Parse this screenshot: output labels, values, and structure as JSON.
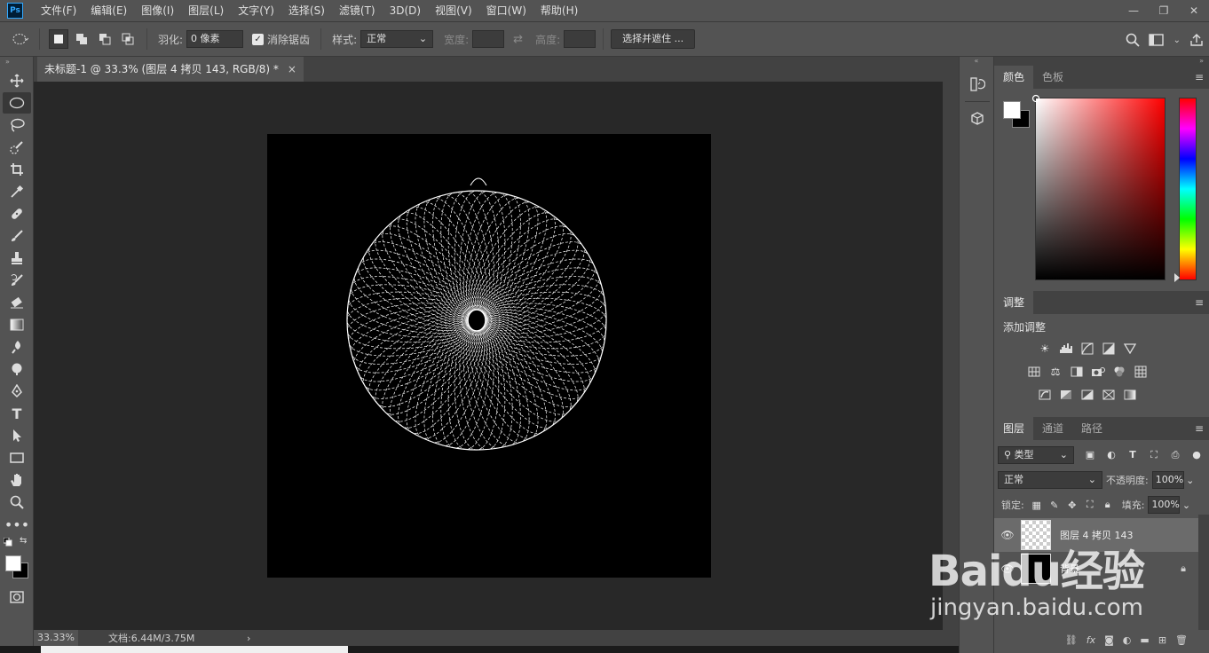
{
  "app": {
    "logo_text": "Ps"
  },
  "menubar": {
    "items": [
      "文件(F)",
      "编辑(E)",
      "图像(I)",
      "图层(L)",
      "文字(Y)",
      "选择(S)",
      "滤镜(T)",
      "3D(D)",
      "视图(V)",
      "窗口(W)",
      "帮助(H)"
    ],
    "window_controls": {
      "minimize": "—",
      "restore": "❐",
      "close": "✕"
    }
  },
  "options": {
    "feather_label": "羽化:",
    "feather_value": "0 像素",
    "antialias_label": "消除锯齿",
    "antialias_checked": true,
    "style_label": "样式:",
    "style_value": "正常",
    "width_label": "宽度:",
    "height_label": "高度:",
    "select_mask_button": "选择并遮住 ..."
  },
  "document": {
    "tab_title": "未标题-1 @ 33.3% (图层 4 拷贝 143, RGB/8) *",
    "tab_close": "×",
    "zoom": "33.33%",
    "doc_info": "文档:6.44M/3.75M",
    "status_arrow": "›"
  },
  "color_panel": {
    "tabs": [
      "颜色",
      "色板"
    ],
    "active_tab": 0,
    "hue_color": "#ff0000"
  },
  "adjustments_panel": {
    "tab": "调整",
    "title": "添加调整"
  },
  "layers_panel": {
    "tabs": [
      "图层",
      "通道",
      "路径"
    ],
    "active_tab": 0,
    "filter_kind": "类型",
    "blend_mode": "正常",
    "opacity_label": "不透明度:",
    "opacity_value": "100%",
    "lock_label": "锁定:",
    "fill_label": "填充:",
    "fill_value": "100%",
    "layers": [
      {
        "name": "图层 4 拷贝 143",
        "selected": true,
        "visible": true,
        "locked": false
      },
      {
        "name": "背景",
        "selected": false,
        "visible": true,
        "locked": true
      }
    ],
    "footer_fx": "fx"
  },
  "watermark": {
    "logo": "Baidu经验",
    "url": "jingyan.baidu.com"
  }
}
